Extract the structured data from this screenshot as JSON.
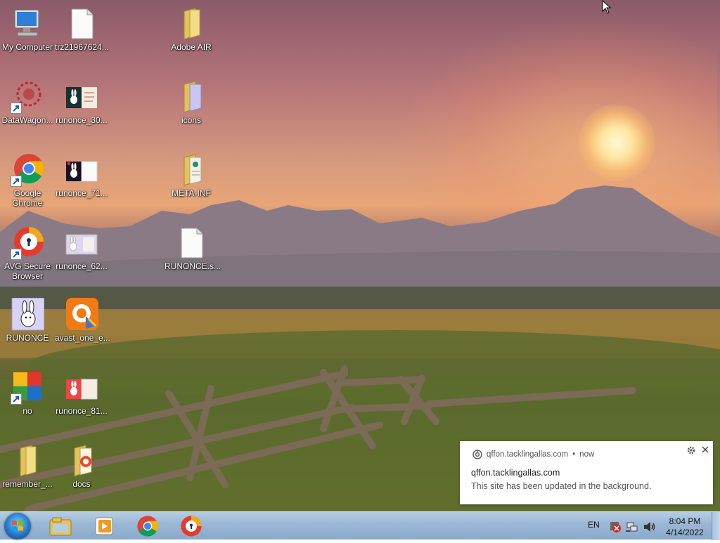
{
  "desktop": {
    "icons": [
      {
        "id": "my-computer",
        "label": "My Computer"
      },
      {
        "id": "trz-file",
        "label": "trz21967624..."
      },
      {
        "id": "adobe-air",
        "label": "Adobe AIR"
      },
      {
        "id": "datawagon",
        "label": "DataWagon..."
      },
      {
        "id": "runonce-30",
        "label": "runonce_30..."
      },
      {
        "id": "icons-folder",
        "label": "icons"
      },
      {
        "id": "google-chrome",
        "label": "Google Chrome"
      },
      {
        "id": "runonce-71",
        "label": "runonce_71..."
      },
      {
        "id": "meta-inf",
        "label": "META-INF"
      },
      {
        "id": "avg-browser",
        "label": "AVG Secure Browser"
      },
      {
        "id": "runonce-62",
        "label": "runonce_62..."
      },
      {
        "id": "runonce-s",
        "label": "RUNONCE.s..."
      },
      {
        "id": "runonce-app",
        "label": "RUNONCE"
      },
      {
        "id": "avast-one",
        "label": "avast_one_e..."
      },
      {
        "id": "no-app",
        "label": "no"
      },
      {
        "id": "runonce-81",
        "label": "runonce_81..."
      },
      {
        "id": "remember",
        "label": "remember_..."
      },
      {
        "id": "docs",
        "label": "docs"
      }
    ]
  },
  "notification": {
    "source": "qffon.tacklingallas.com",
    "separator": "•",
    "time": "now",
    "title": "qffon.tacklingallas.com",
    "body": "This site has been updated in the background."
  },
  "taskbar": {
    "pinned": [
      {
        "name": "explorer",
        "icon": "folder-icon"
      },
      {
        "name": "media-player",
        "icon": "media-player-icon"
      },
      {
        "name": "chrome",
        "icon": "chrome-icon"
      },
      {
        "name": "avg-browser",
        "icon": "avg-browser-icon"
      }
    ],
    "language": "EN",
    "time": "8:04 PM",
    "date": "4/14/2022"
  },
  "colors": {
    "taskbar": "#9ab6d4",
    "chrome_red": "#db4437",
    "chrome_green": "#0f9d58",
    "chrome_yellow": "#f4b400",
    "chrome_blue": "#4285f4"
  }
}
